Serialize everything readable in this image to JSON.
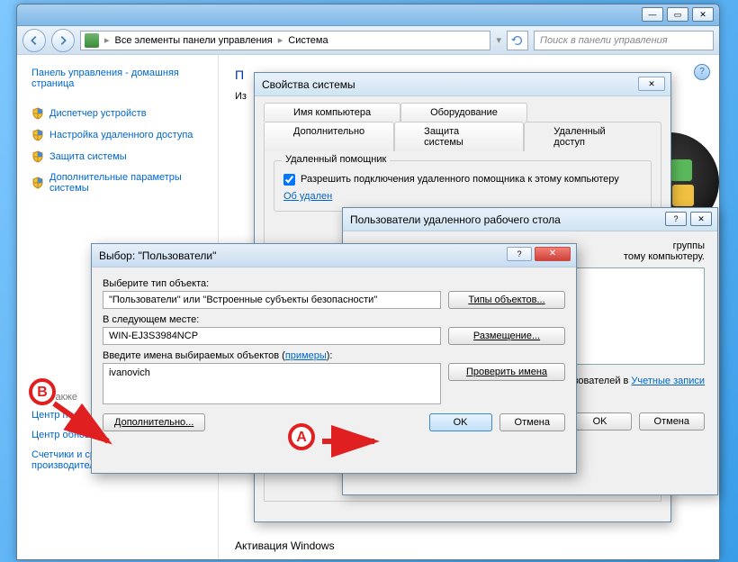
{
  "window": {
    "breadcrumb_root": "Все элементы панели управления",
    "breadcrumb_current": "Система",
    "search_placeholder": "Поиск в панели управления"
  },
  "sidebar": {
    "home": "Панель управления - домашняя страница",
    "links": [
      "Диспетчер устройств",
      "Настройка удаленного доступа",
      "Защита системы",
      "Дополнительные параметры системы"
    ],
    "see_also_head": "См. также",
    "see_also": [
      "Центр поддержки",
      "Центр обновления Windows",
      "Счетчики и средства производительности"
    ]
  },
  "main": {
    "title_prefix": "П",
    "subtitle_prefix": "Из",
    "activation": "Активация Windows"
  },
  "sysprops": {
    "title": "Свойства системы",
    "tabs_top": [
      "Имя компьютера",
      "Оборудование"
    ],
    "tabs_bottom": [
      "Дополнительно",
      "Защита системы",
      "Удаленный доступ"
    ],
    "active_tab": "Удаленный доступ",
    "group_remote_assist": "Удаленный помощник",
    "check_remote_assist": "Разрешить подключения удаленного помощника к этому компьютеру",
    "link_about": "Об удален"
  },
  "remusers": {
    "title": "Пользователи удаленного рабочего стола",
    "desc_tail1": "группы",
    "desc_tail2": "тому компьютеру.",
    "add_hint_part1": "бавить пользователей в",
    "add_hint_link": "Учетные записи",
    "ok": "OK",
    "cancel": "Отмена"
  },
  "selusers": {
    "title": "Выбор: \"Пользователи\"",
    "obj_type_label": "Выберите тип объекта:",
    "obj_type_value": "\"Пользователи\" или \"Встроенные субъекты безопасности\"",
    "obj_type_btn": "Типы объектов...",
    "loc_label": "В следующем месте:",
    "loc_value": "WIN-EJ3S3984NCP",
    "loc_btn": "Размещение...",
    "names_label_pre": "Введите имена выбираемых объектов (",
    "names_label_link": "примеры",
    "names_label_post": "):",
    "names_value": "ivanovich",
    "check_btn": "Проверить имена",
    "advanced_btn": "Дополнительно...",
    "ok": "OK",
    "cancel": "Отмена"
  },
  "callouts": {
    "a": "A",
    "b": "B"
  }
}
